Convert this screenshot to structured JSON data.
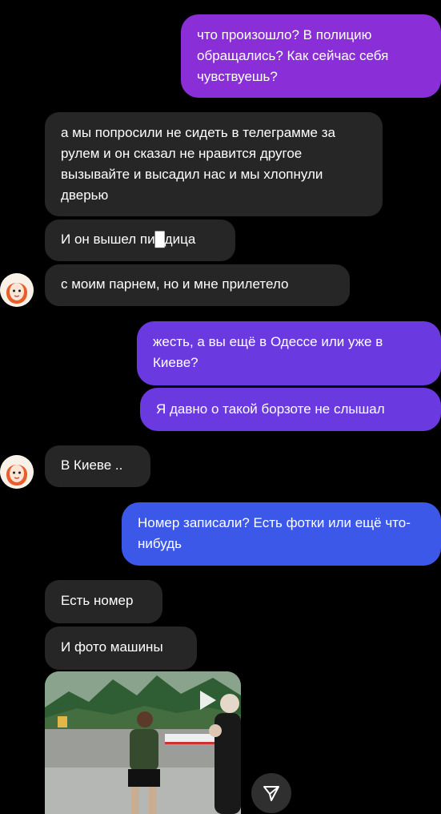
{
  "messages": [
    {
      "side": "out",
      "text": "что произошло? В полицию обращались? Как сейчас себя чувствуешь?"
    },
    {
      "side": "in",
      "text": "а мы попросили не сидеть в телеграмме за рулем и он сказал не нравится другое вызывайте и высадил нас и мы хлопнули дверью"
    },
    {
      "side": "in",
      "text": "И он вышел пи█дица"
    },
    {
      "side": "in",
      "text": "с моим парнем, но и мне прилетело"
    },
    {
      "side": "out",
      "text": "жесть, а вы ещё в Одессе или уже в Киеве?"
    },
    {
      "side": "out",
      "text": "Я давно о такой борзоте не слышал"
    },
    {
      "side": "in",
      "text": "В Киеве .."
    },
    {
      "side": "out",
      "text": "Номер записали? Есть фотки или ещё что-нибудь"
    },
    {
      "side": "in",
      "text": "Есть номер"
    },
    {
      "side": "in",
      "text": "И фото машины"
    }
  ],
  "media": {
    "icon": "play-icon"
  },
  "colors": {
    "incoming": "#262626",
    "out_purple": "#8a2fd7",
    "out_violet": "#6a3ae0",
    "out_blue": "#3c58e8"
  },
  "icons": [
    "avatar-icon",
    "play-icon",
    "send-share-icon"
  ]
}
